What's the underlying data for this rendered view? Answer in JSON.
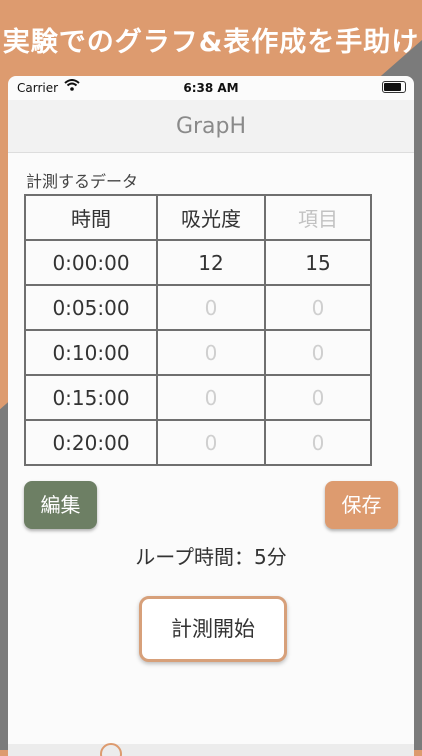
{
  "banner": {
    "text": "実験でのグラフ&表作成を手助け"
  },
  "status_bar": {
    "carrier": "Carrier",
    "time": "6:38 AM"
  },
  "nav": {
    "title": "GrapH"
  },
  "section": {
    "label": "計測するデータ"
  },
  "table": {
    "headers": [
      "時間",
      "吸光度",
      "項目"
    ],
    "rows": [
      [
        "0:00:00",
        "12",
        "15"
      ],
      [
        "0:05:00",
        "0",
        "0"
      ],
      [
        "0:10:00",
        "0",
        "0"
      ],
      [
        "0:15:00",
        "0",
        "0"
      ],
      [
        "0:20:00",
        "0",
        "0"
      ]
    ]
  },
  "buttons": {
    "edit": "編集",
    "save": "保存",
    "start": "計測開始"
  },
  "loop": {
    "text": "ループ時間：5分"
  },
  "colors": {
    "accent": "#dd9b6f",
    "edit_green": "#6d7f64",
    "gray_bg": "#7b7b7b"
  },
  "icons": {
    "wifi": "wifi-icon",
    "battery": "battery-icon"
  }
}
